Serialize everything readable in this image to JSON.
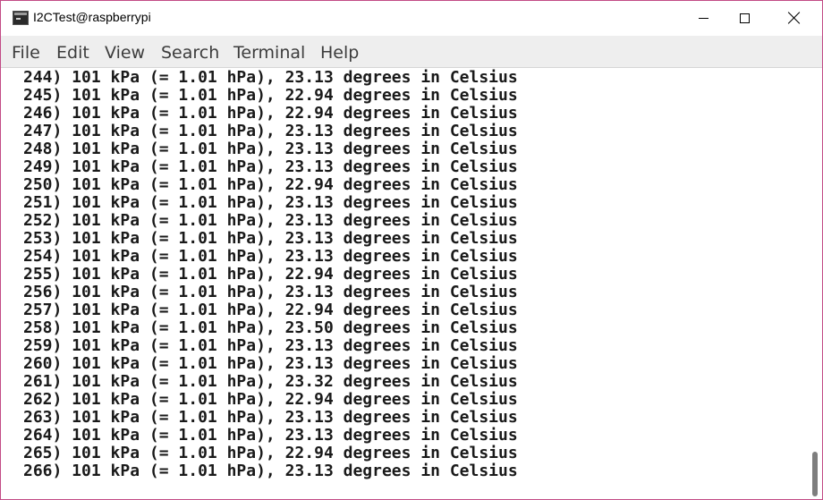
{
  "window": {
    "title": "I2CTest@raspberrypi",
    "icon": "terminal-icon"
  },
  "menu": {
    "items": [
      "File",
      "Edit",
      "View",
      "Search",
      "Terminal",
      "Help"
    ]
  },
  "terminal": {
    "lines": [
      "244) 101 kPa (= 1.01 hPa), 23.13 degrees in Celsius",
      "245) 101 kPa (= 1.01 hPa), 22.94 degrees in Celsius",
      "246) 101 kPa (= 1.01 hPa), 22.94 degrees in Celsius",
      "247) 101 kPa (= 1.01 hPa), 23.13 degrees in Celsius",
      "248) 101 kPa (= 1.01 hPa), 23.13 degrees in Celsius",
      "249) 101 kPa (= 1.01 hPa), 23.13 degrees in Celsius",
      "250) 101 kPa (= 1.01 hPa), 22.94 degrees in Celsius",
      "251) 101 kPa (= 1.01 hPa), 23.13 degrees in Celsius",
      "252) 101 kPa (= 1.01 hPa), 23.13 degrees in Celsius",
      "253) 101 kPa (= 1.01 hPa), 23.13 degrees in Celsius",
      "254) 101 kPa (= 1.01 hPa), 23.13 degrees in Celsius",
      "255) 101 kPa (= 1.01 hPa), 22.94 degrees in Celsius",
      "256) 101 kPa (= 1.01 hPa), 23.13 degrees in Celsius",
      "257) 101 kPa (= 1.01 hPa), 22.94 degrees in Celsius",
      "258) 101 kPa (= 1.01 hPa), 23.50 degrees in Celsius",
      "259) 101 kPa (= 1.01 hPa), 23.13 degrees in Celsius",
      "260) 101 kPa (= 1.01 hPa), 23.13 degrees in Celsius",
      "261) 101 kPa (= 1.01 hPa), 23.32 degrees in Celsius",
      "262) 101 kPa (= 1.01 hPa), 22.94 degrees in Celsius",
      "263) 101 kPa (= 1.01 hPa), 23.13 degrees in Celsius",
      "264) 101 kPa (= 1.01 hPa), 23.13 degrees in Celsius",
      "265) 101 kPa (= 1.01 hPa), 22.94 degrees in Celsius",
      "266) 101 kPa (= 1.01 hPa), 23.13 degrees in Celsius"
    ]
  },
  "colors": {
    "window_border": "#c24b86",
    "menubar_bg": "#eeeeee",
    "terminal_text": "#1a1a1a"
  }
}
